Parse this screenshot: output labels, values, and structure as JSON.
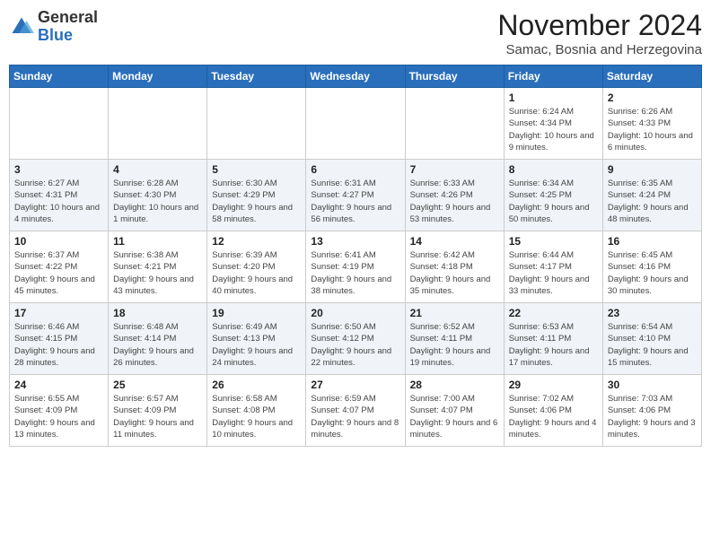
{
  "logo": {
    "general": "General",
    "blue": "Blue"
  },
  "header": {
    "month": "November 2024",
    "location": "Samac, Bosnia and Herzegovina"
  },
  "weekdays": [
    "Sunday",
    "Monday",
    "Tuesday",
    "Wednesday",
    "Thursday",
    "Friday",
    "Saturday"
  ],
  "weeks": [
    [
      {
        "day": "",
        "info": ""
      },
      {
        "day": "",
        "info": ""
      },
      {
        "day": "",
        "info": ""
      },
      {
        "day": "",
        "info": ""
      },
      {
        "day": "",
        "info": ""
      },
      {
        "day": "1",
        "info": "Sunrise: 6:24 AM\nSunset: 4:34 PM\nDaylight: 10 hours and 9 minutes."
      },
      {
        "day": "2",
        "info": "Sunrise: 6:26 AM\nSunset: 4:33 PM\nDaylight: 10 hours and 6 minutes."
      }
    ],
    [
      {
        "day": "3",
        "info": "Sunrise: 6:27 AM\nSunset: 4:31 PM\nDaylight: 10 hours and 4 minutes."
      },
      {
        "day": "4",
        "info": "Sunrise: 6:28 AM\nSunset: 4:30 PM\nDaylight: 10 hours and 1 minute."
      },
      {
        "day": "5",
        "info": "Sunrise: 6:30 AM\nSunset: 4:29 PM\nDaylight: 9 hours and 58 minutes."
      },
      {
        "day": "6",
        "info": "Sunrise: 6:31 AM\nSunset: 4:27 PM\nDaylight: 9 hours and 56 minutes."
      },
      {
        "day": "7",
        "info": "Sunrise: 6:33 AM\nSunset: 4:26 PM\nDaylight: 9 hours and 53 minutes."
      },
      {
        "day": "8",
        "info": "Sunrise: 6:34 AM\nSunset: 4:25 PM\nDaylight: 9 hours and 50 minutes."
      },
      {
        "day": "9",
        "info": "Sunrise: 6:35 AM\nSunset: 4:24 PM\nDaylight: 9 hours and 48 minutes."
      }
    ],
    [
      {
        "day": "10",
        "info": "Sunrise: 6:37 AM\nSunset: 4:22 PM\nDaylight: 9 hours and 45 minutes."
      },
      {
        "day": "11",
        "info": "Sunrise: 6:38 AM\nSunset: 4:21 PM\nDaylight: 9 hours and 43 minutes."
      },
      {
        "day": "12",
        "info": "Sunrise: 6:39 AM\nSunset: 4:20 PM\nDaylight: 9 hours and 40 minutes."
      },
      {
        "day": "13",
        "info": "Sunrise: 6:41 AM\nSunset: 4:19 PM\nDaylight: 9 hours and 38 minutes."
      },
      {
        "day": "14",
        "info": "Sunrise: 6:42 AM\nSunset: 4:18 PM\nDaylight: 9 hours and 35 minutes."
      },
      {
        "day": "15",
        "info": "Sunrise: 6:44 AM\nSunset: 4:17 PM\nDaylight: 9 hours and 33 minutes."
      },
      {
        "day": "16",
        "info": "Sunrise: 6:45 AM\nSunset: 4:16 PM\nDaylight: 9 hours and 30 minutes."
      }
    ],
    [
      {
        "day": "17",
        "info": "Sunrise: 6:46 AM\nSunset: 4:15 PM\nDaylight: 9 hours and 28 minutes."
      },
      {
        "day": "18",
        "info": "Sunrise: 6:48 AM\nSunset: 4:14 PM\nDaylight: 9 hours and 26 minutes."
      },
      {
        "day": "19",
        "info": "Sunrise: 6:49 AM\nSunset: 4:13 PM\nDaylight: 9 hours and 24 minutes."
      },
      {
        "day": "20",
        "info": "Sunrise: 6:50 AM\nSunset: 4:12 PM\nDaylight: 9 hours and 22 minutes."
      },
      {
        "day": "21",
        "info": "Sunrise: 6:52 AM\nSunset: 4:11 PM\nDaylight: 9 hours and 19 minutes."
      },
      {
        "day": "22",
        "info": "Sunrise: 6:53 AM\nSunset: 4:11 PM\nDaylight: 9 hours and 17 minutes."
      },
      {
        "day": "23",
        "info": "Sunrise: 6:54 AM\nSunset: 4:10 PM\nDaylight: 9 hours and 15 minutes."
      }
    ],
    [
      {
        "day": "24",
        "info": "Sunrise: 6:55 AM\nSunset: 4:09 PM\nDaylight: 9 hours and 13 minutes."
      },
      {
        "day": "25",
        "info": "Sunrise: 6:57 AM\nSunset: 4:09 PM\nDaylight: 9 hours and 11 minutes."
      },
      {
        "day": "26",
        "info": "Sunrise: 6:58 AM\nSunset: 4:08 PM\nDaylight: 9 hours and 10 minutes."
      },
      {
        "day": "27",
        "info": "Sunrise: 6:59 AM\nSunset: 4:07 PM\nDaylight: 9 hours and 8 minutes."
      },
      {
        "day": "28",
        "info": "Sunrise: 7:00 AM\nSunset: 4:07 PM\nDaylight: 9 hours and 6 minutes."
      },
      {
        "day": "29",
        "info": "Sunrise: 7:02 AM\nSunset: 4:06 PM\nDaylight: 9 hours and 4 minutes."
      },
      {
        "day": "30",
        "info": "Sunrise: 7:03 AM\nSunset: 4:06 PM\nDaylight: 9 hours and 3 minutes."
      }
    ]
  ]
}
